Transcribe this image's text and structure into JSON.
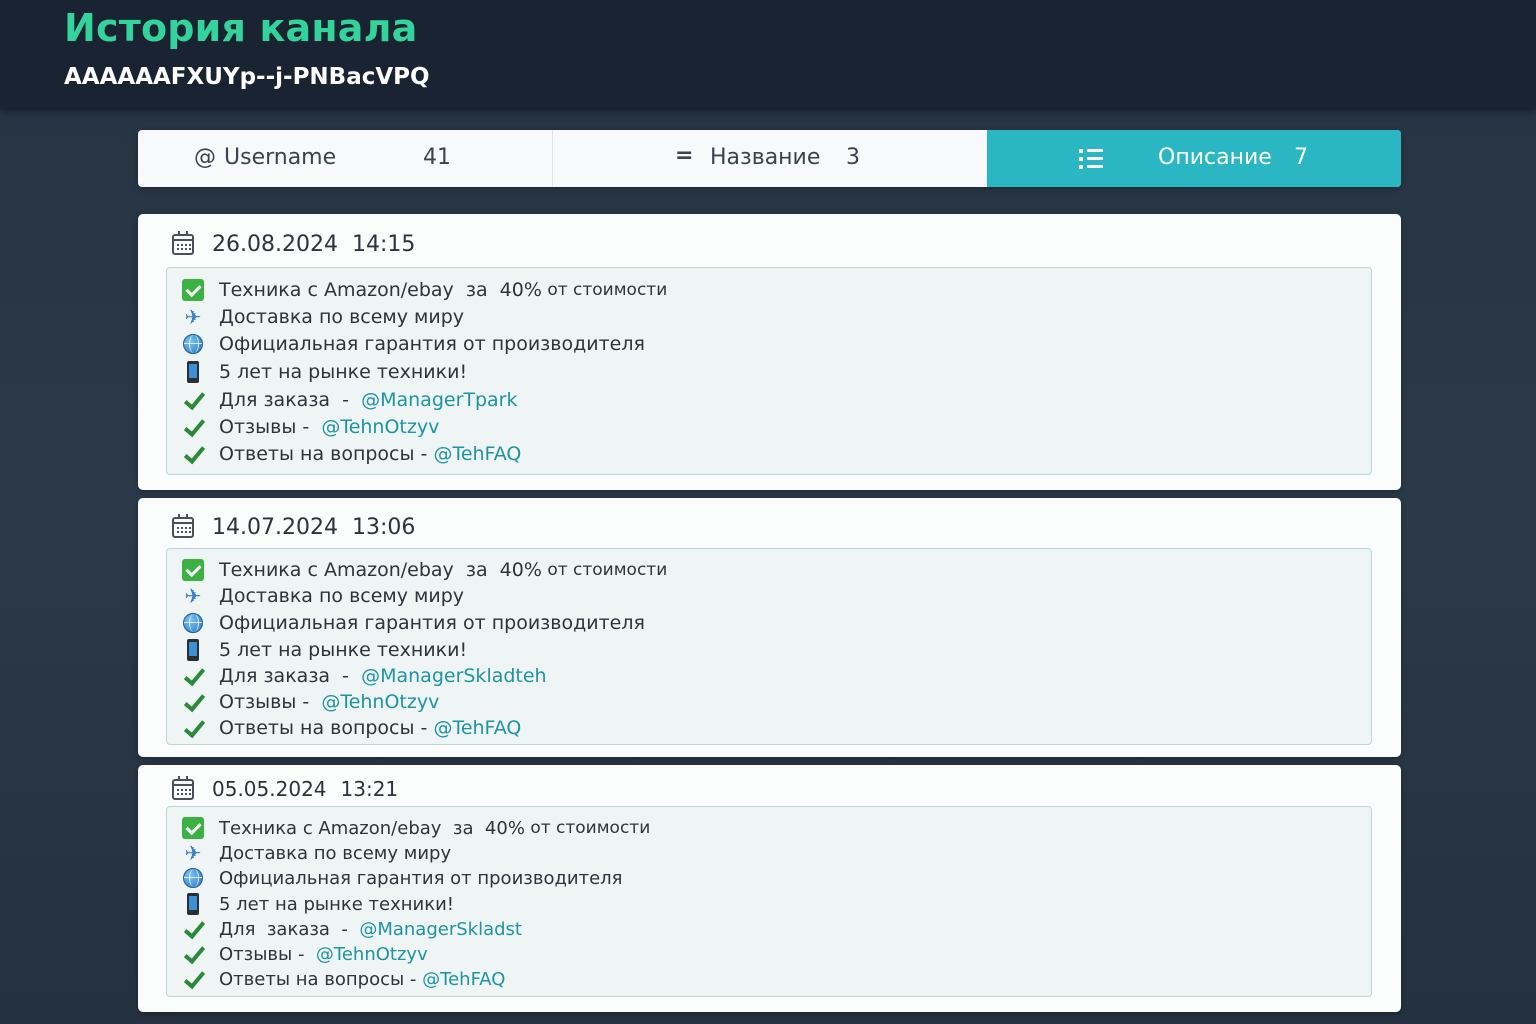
{
  "header": {
    "title": "История канала",
    "channel_id": "AAAAAAFXUYp--j-PNBacVPQ"
  },
  "tabs": [
    {
      "icon": "@",
      "label": "Username",
      "count": "41"
    },
    {
      "icon": "=",
      "label": "Название",
      "count": "3"
    },
    {
      "icon": "list-icon",
      "label": "Описание",
      "count": "7",
      "active": true
    }
  ],
  "colors": {
    "accent": "#2bb6c3",
    "title_green": "#34d39c",
    "link": "#1f93a3"
  },
  "entries": [
    {
      "date": "26.08.2024",
      "time": "14:15",
      "lines": {
        "l1_text": "Техника с Amazon/ebay  за  40%",
        "l1_small": " от стоимости",
        "l2": "Доставка по всему миру",
        "l3": "Официальная гарантия от производителя",
        "l4": "5 лет на рынке техники!",
        "l5_text": "Для заказа  -  ",
        "l5_link": "@ManagerTpark",
        "l6_text": "Отзывы -  ",
        "l6_link": "@TehnOtzyv",
        "l7_text": "Ответы на вопросы - ",
        "l7_link": "@TehFAQ"
      }
    },
    {
      "date": "14.07.2024",
      "time": "13:06",
      "lines": {
        "l1_text": "Техника с Amazon/ebay  за  40%",
        "l1_small": " от стоимости",
        "l2": "Доставка по всему миру",
        "l3": "Официальная гарантия от производителя",
        "l4": "5 лет на рынке техники!",
        "l5_text": "Для заказа  -  ",
        "l5_link": "@ManagerSkladteh",
        "l6_text": "Отзывы -  ",
        "l6_link": "@TehnOtzyv",
        "l7_text": "Ответы на вопросы - ",
        "l7_link": "@TehFAQ"
      }
    },
    {
      "date": "05.05.2024",
      "time": "13:21",
      "lines": {
        "l1_text": "Техника с Amazon/ebay  за  40%",
        "l1_small": " от стоимости",
        "l2": "Доставка по всему миру",
        "l3": "Официальная гарантия от производителя",
        "l4": "5 лет на рынке техники!",
        "l5_text": "Для  заказа  -  ",
        "l5_link": "@ManagerSkladst",
        "l6_text": "Отзывы -  ",
        "l6_link": "@TehnOtzyv",
        "l7_text": "Ответы на вопросы - ",
        "l7_link": "@TehFAQ"
      }
    }
  ]
}
